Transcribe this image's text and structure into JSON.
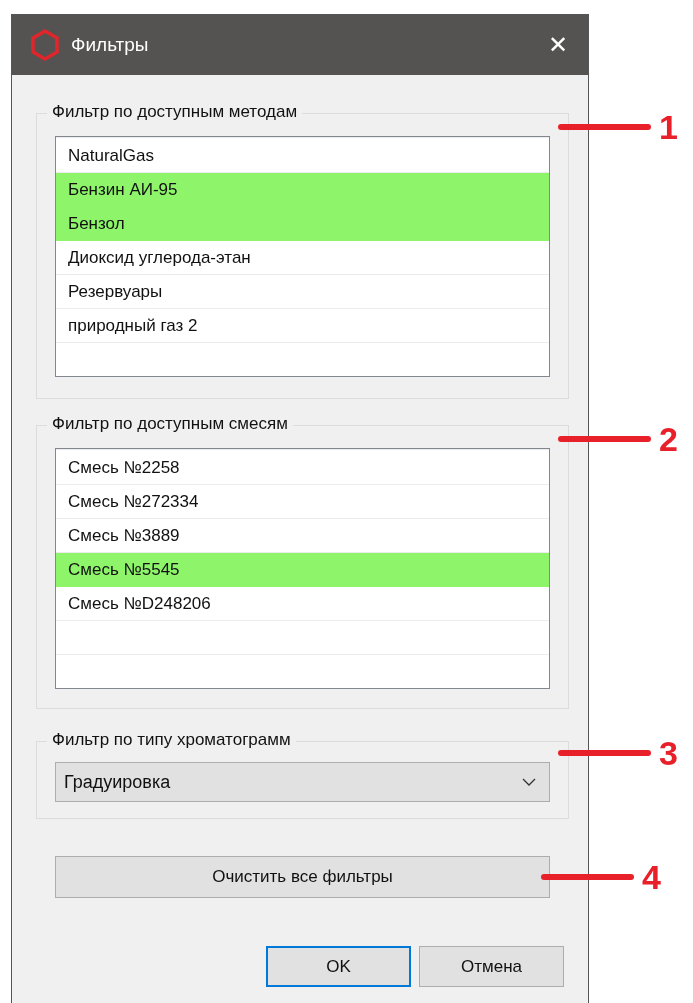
{
  "window": {
    "title": "Фильтры",
    "close": "✕"
  },
  "methods": {
    "legend": "Фильтр по доступным методам",
    "callout": "1",
    "items": [
      {
        "label": "NaturalGas",
        "selected": false
      },
      {
        "label": "Бензин АИ-95",
        "selected": true
      },
      {
        "label": "Бензол",
        "selected": true
      },
      {
        "label": "Диоксид углерода-этан",
        "selected": false
      },
      {
        "label": "Резервуары",
        "selected": false
      },
      {
        "label": "природный газ 2",
        "selected": false
      }
    ]
  },
  "mixtures": {
    "legend": "Фильтр по доступным смесям",
    "callout": "2",
    "items": [
      {
        "label": "Смесь №2258",
        "selected": false
      },
      {
        "label": "Смесь №272334",
        "selected": false
      },
      {
        "label": "Смесь №3889",
        "selected": false
      },
      {
        "label": "Смесь №5545",
        "selected": true
      },
      {
        "label": "Смесь №D248206",
        "selected": false
      }
    ]
  },
  "chromatogram_type": {
    "legend": "Фильтр по типу хроматограмм",
    "callout": "3",
    "value": "Градуировка"
  },
  "clear_button": {
    "label": "Очистить все фильтры",
    "callout": "4"
  },
  "buttons": [
    {
      "label": "OK",
      "focused": true
    },
    {
      "label": "Отмена",
      "focused": false
    }
  ]
}
